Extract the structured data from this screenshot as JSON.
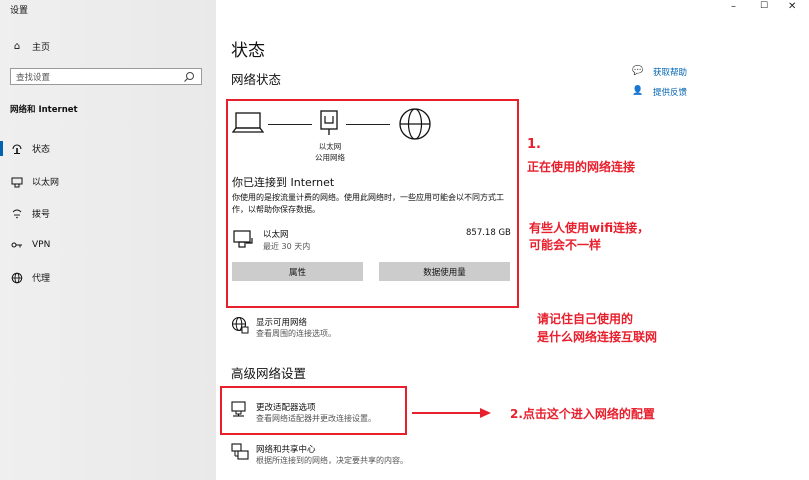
{
  "window": {
    "title": "设置",
    "minimize": "–",
    "maximize": "☐",
    "close": "✕"
  },
  "sidebar": {
    "home": "主页",
    "search_placeholder": "查找设置",
    "section": "网络和 Internet",
    "items": [
      {
        "label": "状态",
        "icon": "status-icon"
      },
      {
        "label": "以太网",
        "icon": "ethernet-icon"
      },
      {
        "label": "拨号",
        "icon": "dialup-icon"
      },
      {
        "label": "VPN",
        "icon": "vpn-icon"
      },
      {
        "label": "代理",
        "icon": "proxy-icon"
      }
    ]
  },
  "main": {
    "title": "状态",
    "network_status": "网络状态",
    "help": {
      "get_help": "获取帮助",
      "feedback": "提供反馈"
    },
    "diagram": {
      "caption_line1": "以太网",
      "caption_line2": "公用网络"
    },
    "connected_title": "你已连接到 Internet",
    "connected_desc": "你使用的是按流量计费的网络。使用此网络时，一些应用可能会以不同方式工作，以帮助你保存数据。",
    "ethernet": {
      "name": "以太网",
      "sub": "最近 30 天内",
      "usage": "857.18 GB"
    },
    "buttons": {
      "properties": "属性",
      "data_usage": "数据使用量"
    },
    "show_networks": {
      "title": "显示可用网络",
      "sub": "查看周围的连接选项。"
    },
    "advanced_title": "高级网络设置",
    "adapter": {
      "title": "更改适配器选项",
      "sub": "查看网络适配器并更改连接设置。"
    },
    "sharing": {
      "title": "网络和共享中心",
      "sub": "根据所连接到的网络，决定要共享的内容。"
    }
  },
  "annotations": {
    "a1_num": "1.",
    "a1_text": "正在使用的网络连接",
    "a2_line1": "有些人使用wifi连接，",
    "a2_line2": "可能会不一样",
    "a3_line1": "请记住自己使用的",
    "a3_line2": "是什么网络连接互联网",
    "a4": "2.点击这个进入网络的配置"
  },
  "colors": {
    "accent": "#0063b1",
    "annotation": "#e8202e",
    "button": "#cccccc"
  }
}
